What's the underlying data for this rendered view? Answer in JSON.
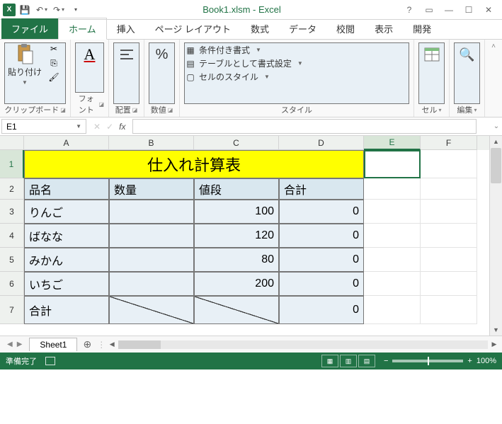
{
  "window": {
    "title": "Book1.xlsm - Excel"
  },
  "qat": {
    "save": "💾",
    "undo": "↶",
    "redo": "↷"
  },
  "tabs": {
    "file": "ファイル",
    "home": "ホーム",
    "insert": "挿入",
    "pagelayout": "ページ レイアウト",
    "formulas": "数式",
    "data": "データ",
    "review": "校閲",
    "view": "表示",
    "developer": "開発"
  },
  "ribbon": {
    "clipboard_label": "クリップボード",
    "paste": "貼り付け",
    "font_label": "フォント",
    "align_label": "配置",
    "number_label": "数値",
    "styles_label": "スタイル",
    "cond_fmt": "条件付き書式",
    "table_fmt": "テーブルとして書式設定",
    "cell_styles": "セルのスタイル",
    "cells_label": "セル",
    "edit_label": "編集"
  },
  "namebox": "E1",
  "columns": [
    "A",
    "B",
    "C",
    "D",
    "E",
    "F"
  ],
  "rows": [
    "1",
    "2",
    "3",
    "4",
    "5",
    "6",
    "7"
  ],
  "sheet": {
    "title": "仕入れ計算表",
    "headers": {
      "name": "品名",
      "qty": "数量",
      "price": "値段",
      "total": "合計"
    },
    "items": [
      {
        "name": "りんご",
        "qty": "",
        "price": "100",
        "total": "0"
      },
      {
        "name": "ばなな",
        "qty": "",
        "price": "120",
        "total": "0"
      },
      {
        "name": "みかん",
        "qty": "",
        "price": "80",
        "total": "0"
      },
      {
        "name": "いちご",
        "qty": "",
        "price": "200",
        "total": "0"
      }
    ],
    "footer": {
      "label": "合計",
      "total": "0"
    }
  },
  "sheet_tab": "Sheet1",
  "status": {
    "ready": "準備完了",
    "zoom": "100%"
  }
}
